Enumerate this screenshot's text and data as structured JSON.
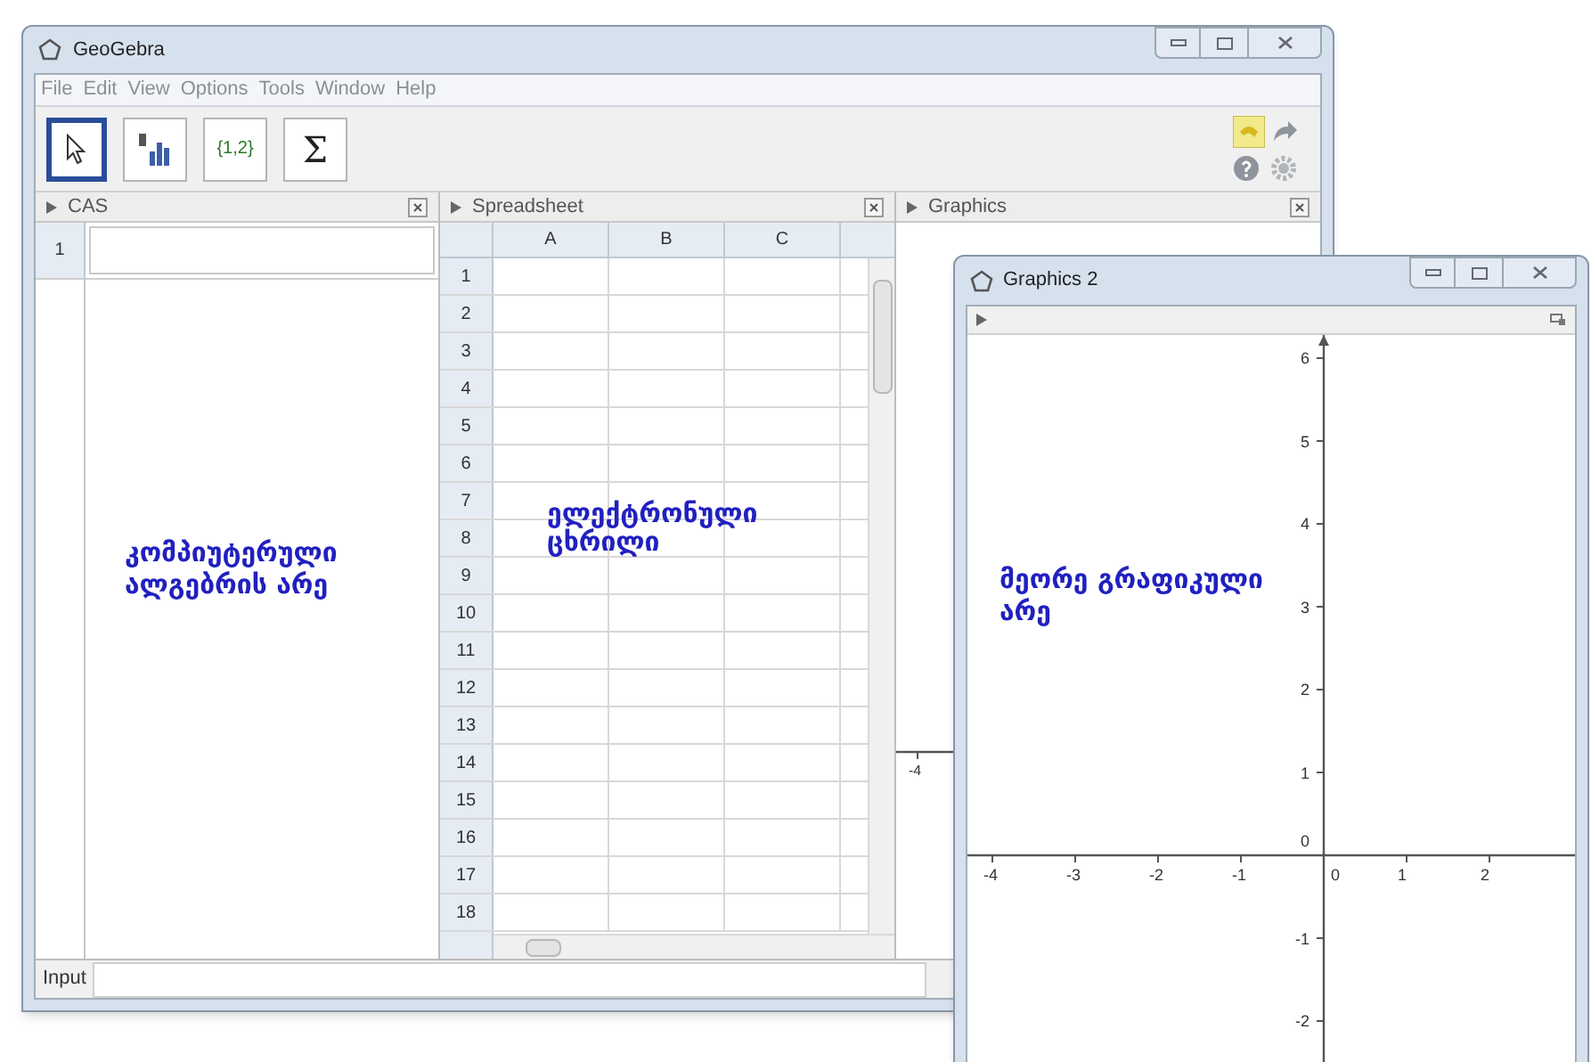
{
  "main_window": {
    "title": "GeoGebra",
    "menu": [
      "File",
      "Edit",
      "View",
      "Options",
      "Tools",
      "Window",
      "Help"
    ],
    "toolbar": [
      {
        "kind": "move",
        "selected": true
      },
      {
        "kind": "chart",
        "selected": false
      },
      {
        "kind": "list",
        "label": "{1,2}",
        "selected": false
      },
      {
        "kind": "sum",
        "label": "Σ",
        "selected": false
      }
    ],
    "cas": {
      "title": "CAS",
      "rows": [
        "1"
      ],
      "note": "კომპიუტერული ალგებრის არე"
    },
    "spreadsheet": {
      "title": "Spreadsheet",
      "columns": [
        "A",
        "B",
        "C"
      ],
      "rows": [
        "1",
        "2",
        "3",
        "4",
        "5",
        "6",
        "7",
        "8",
        "9",
        "10",
        "11",
        "12",
        "13",
        "14",
        "15",
        "16",
        "17",
        "18"
      ],
      "note": "ელექტრონული ცხრილი"
    },
    "graphics": {
      "title": "Graphics",
      "x_tick": "-4"
    },
    "input_bar": {
      "label": "Input"
    }
  },
  "graphics2_window": {
    "title": "Graphics 2",
    "x_ticks": [
      "-4",
      "-3",
      "-2",
      "-1",
      "0",
      "1",
      "2"
    ],
    "y_ticks": [
      "6",
      "5",
      "4",
      "3",
      "2",
      "1",
      "0",
      "-1",
      "-2"
    ],
    "note": "მეორე გრაფიკული არე"
  }
}
